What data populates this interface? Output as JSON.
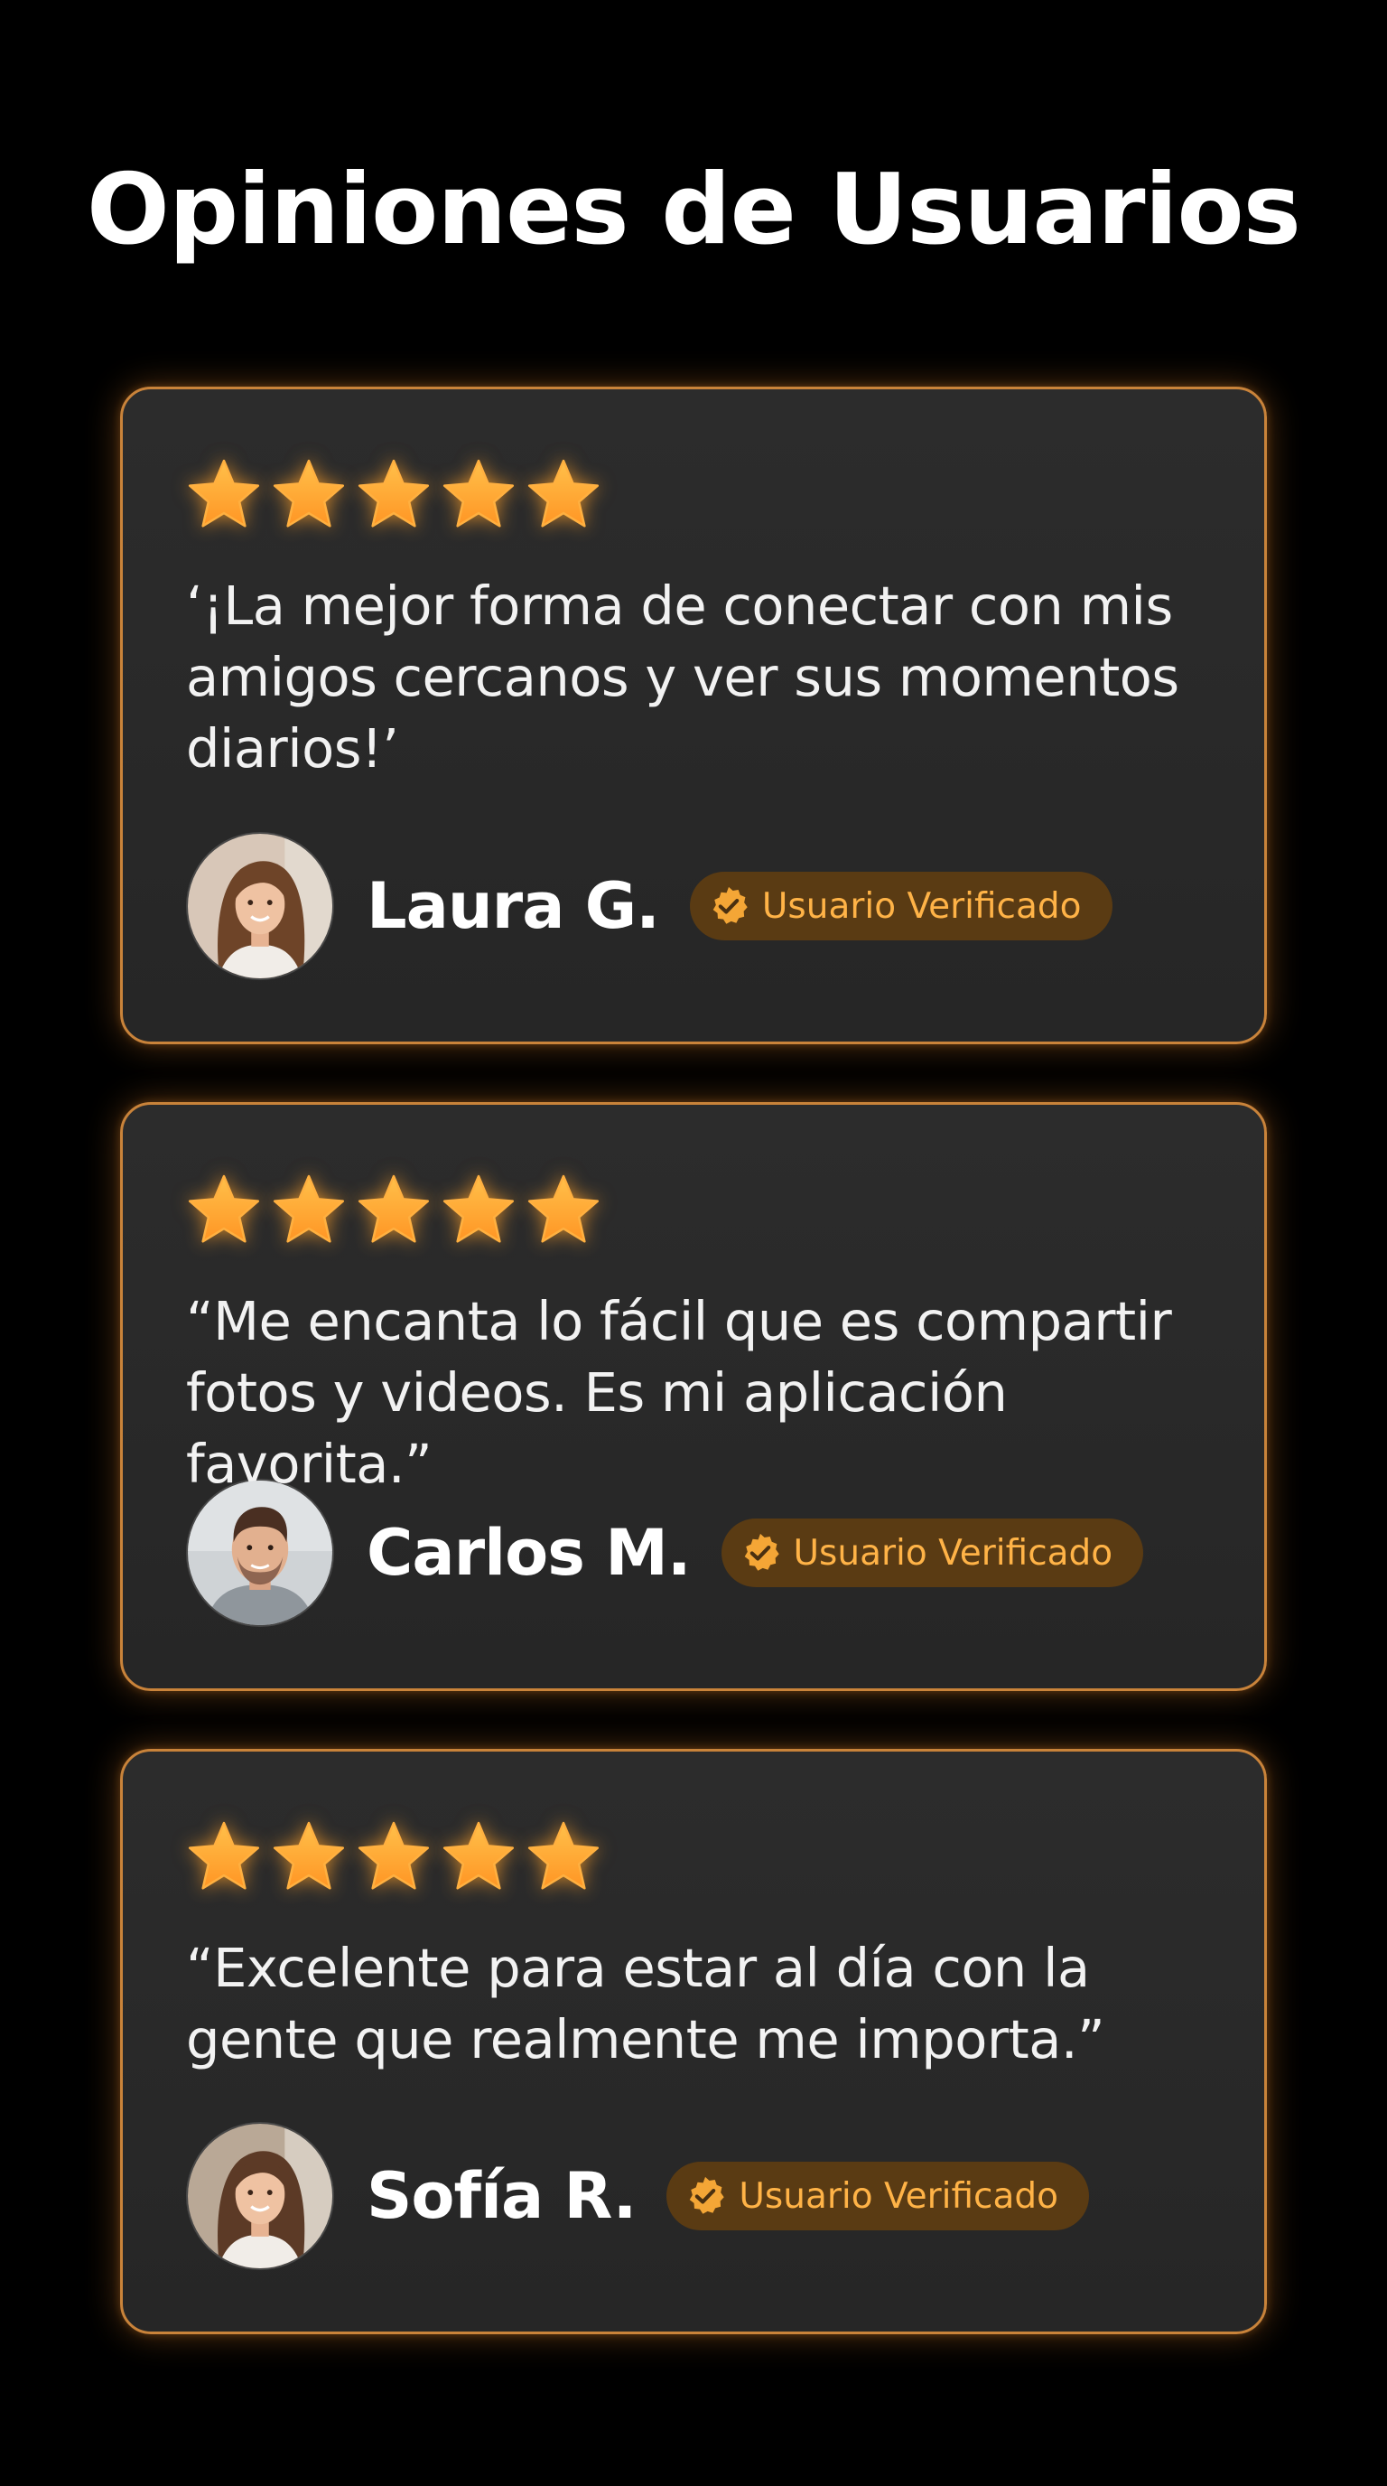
{
  "header": {
    "title": "Opiniones de Usuarios"
  },
  "colors": {
    "background": "#000000",
    "card_background": "#2a2a2a",
    "card_border": "#c9833a",
    "star": "#ffa832",
    "badge_background": "#5a3b13",
    "badge_text": "#ffb347"
  },
  "reviews": [
    {
      "rating": 5,
      "quote": "‘¡La mejor forma de conectar con mis amigos cercanos y ver sus momentos diarios!’",
      "author": "Laura G.",
      "badge": "Usuario Verificado",
      "badge_icon": "verified-check-icon",
      "avatar_icon": "woman-avatar"
    },
    {
      "rating": 5,
      "quote": "“Me encanta lo fácil que es compartir fotos y videos. Es mi aplicación favorita.”",
      "author": "Carlos M.",
      "badge": "Usuario Verificado",
      "badge_icon": "verified-check-icon",
      "avatar_icon": "man-avatar"
    },
    {
      "rating": 5,
      "quote": "“Excelente para estar al día con la gente que realmente me importa.”",
      "author": "Sofía R.",
      "badge": "Usuario Verificado",
      "badge_icon": "verified-check-icon",
      "avatar_icon": "woman-avatar"
    }
  ]
}
